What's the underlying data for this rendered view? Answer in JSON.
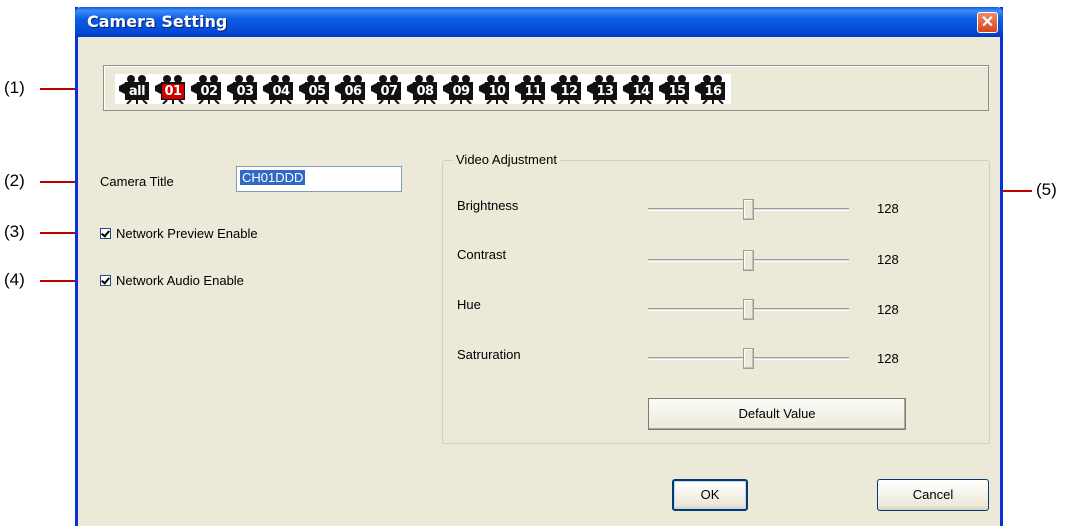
{
  "callouts": [
    "(1)",
    "(2)",
    "(3)",
    "(4)",
    "(5)"
  ],
  "window": {
    "title": "Camera Setting",
    "close_label": "✕"
  },
  "cameras": [
    {
      "label": "all",
      "active": false
    },
    {
      "label": "01",
      "active": true
    },
    {
      "label": "02",
      "active": false
    },
    {
      "label": "03",
      "active": false
    },
    {
      "label": "04",
      "active": false
    },
    {
      "label": "05",
      "active": false
    },
    {
      "label": "06",
      "active": false
    },
    {
      "label": "07",
      "active": false
    },
    {
      "label": "08",
      "active": false
    },
    {
      "label": "09",
      "active": false
    },
    {
      "label": "10",
      "active": false
    },
    {
      "label": "11",
      "active": false
    },
    {
      "label": "12",
      "active": false
    },
    {
      "label": "13",
      "active": false
    },
    {
      "label": "14",
      "active": false
    },
    {
      "label": "15",
      "active": false
    },
    {
      "label": "16",
      "active": false
    }
  ],
  "camera_title": {
    "label": "Camera Title",
    "value": "CH01DDD"
  },
  "network_preview": {
    "label": "Network Preview Enable",
    "checked": true
  },
  "network_audio": {
    "label": "Network Audio Enable",
    "checked": true
  },
  "video_adjustment": {
    "title": "Video Adjustment",
    "sliders": [
      {
        "label": "Brightness",
        "value": "128",
        "fraction": 0.5
      },
      {
        "label": "Contrast",
        "value": "128",
        "fraction": 0.5
      },
      {
        "label": "Hue",
        "value": "128",
        "fraction": 0.5
      },
      {
        "label": "Satruration",
        "value": "128",
        "fraction": 0.5
      }
    ],
    "default_button": "Default Value"
  },
  "buttons": {
    "ok": "OK",
    "cancel": "Cancel"
  },
  "colors": {
    "titlebar": "#0a5de4",
    "dialog_bg": "#ece9d8",
    "callout_line": "#c00000",
    "active_camera": "#d00000"
  }
}
